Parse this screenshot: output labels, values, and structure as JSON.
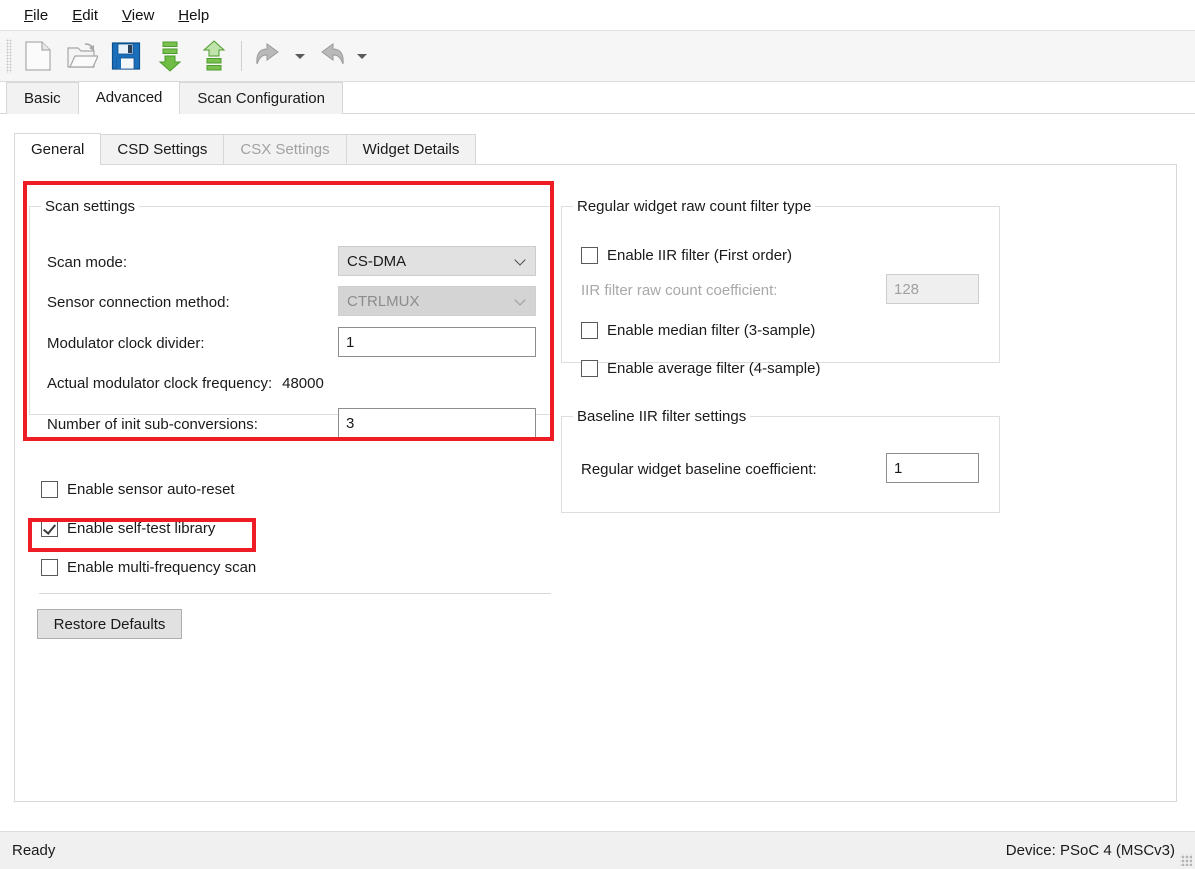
{
  "menubar": {
    "items": [
      {
        "mnemonic": "F",
        "rest": "ile"
      },
      {
        "mnemonic": "E",
        "rest": "dit"
      },
      {
        "mnemonic": "V",
        "rest": "iew"
      },
      {
        "mnemonic": "H",
        "rest": "elp"
      }
    ]
  },
  "toolbar": {
    "buttons": [
      {
        "name": "new-file-icon",
        "tip": "New"
      },
      {
        "name": "open-folder-icon",
        "tip": "Open"
      },
      {
        "name": "save-disk-icon",
        "tip": "Save"
      },
      {
        "name": "download-arrow-icon",
        "tip": "Import"
      },
      {
        "name": "upload-arrow-icon",
        "tip": "Export"
      },
      {
        "name": "undo-arrow-icon",
        "tip": "Undo"
      },
      {
        "name": "redo-arrow-icon",
        "tip": "Redo"
      }
    ]
  },
  "outer_tabs": [
    {
      "label": "Basic",
      "active": false
    },
    {
      "label": "Advanced",
      "active": true
    },
    {
      "label": "Scan Configuration",
      "active": false
    }
  ],
  "inner_tabs": [
    {
      "label": "General",
      "active": true,
      "disabled": false
    },
    {
      "label": "CSD Settings",
      "active": false,
      "disabled": false
    },
    {
      "label": "CSX Settings",
      "active": false,
      "disabled": true
    },
    {
      "label": "Widget Details",
      "active": false,
      "disabled": false
    }
  ],
  "scan_settings": {
    "title": "Scan settings",
    "scan_mode": {
      "label": "Scan mode:",
      "value": "CS-DMA",
      "disabled": false
    },
    "sensor_connection_method": {
      "label": "Sensor connection method:",
      "value": "CTRLMUX",
      "disabled": true
    },
    "modulator_clock_divider": {
      "label": "Modulator clock divider:",
      "value": "1"
    },
    "actual_modulator_clock_frequency": {
      "label": "Actual modulator clock frequency:",
      "value": "48000"
    },
    "number_of_init_sub_conversions": {
      "label": "Number of init sub-conversions:",
      "value": "3"
    }
  },
  "left_checkboxes": [
    {
      "label": "Enable sensor auto-reset",
      "checked": false
    },
    {
      "label": "Enable self-test library",
      "checked": true
    },
    {
      "label": "Enable multi-frequency scan",
      "checked": false
    }
  ],
  "restore_defaults_button": "Restore Defaults",
  "raw_count_filter": {
    "title": "Regular widget raw count filter type",
    "iir_filter": {
      "label": "Enable IIR filter (First order)",
      "checked": false
    },
    "iir_coefficient": {
      "label": "IIR filter raw count coefficient:",
      "value": "128",
      "disabled": true
    },
    "median_filter": {
      "label": "Enable median filter (3-sample)",
      "checked": false
    },
    "average_filter": {
      "label": "Enable average filter (4-sample)",
      "checked": false
    }
  },
  "baseline_filter": {
    "title": "Baseline IIR filter settings",
    "baseline_coefficient": {
      "label": "Regular widget baseline coefficient:",
      "value": "1"
    }
  },
  "statusbar": {
    "left": "Ready",
    "right": "Device: PSoC 4 (MSCv3)"
  },
  "highlights": {
    "color": "#ee1c25",
    "boxes": [
      "scan-settings-group",
      "enable-self-test-library-checkbox"
    ]
  }
}
